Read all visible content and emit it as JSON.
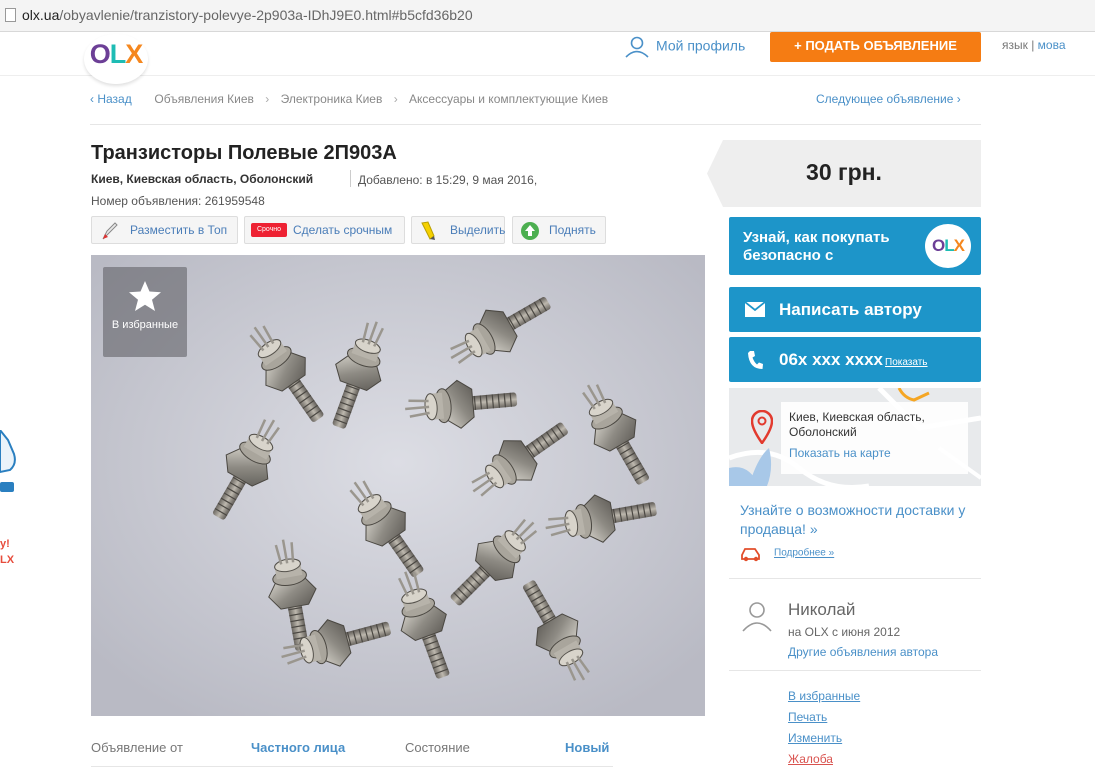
{
  "browser": {
    "url_domain": "olx.ua",
    "url_path": "/obyavlenie/tranzistory-polevye-2p903a-IDhJ9E0.html#b5cfd36b20"
  },
  "header": {
    "logo": "OLX",
    "profile_label": "Мой профиль",
    "post_button": "ПОДАТЬ ОБЪЯВЛЕНИЕ",
    "lang_label": "язык",
    "lang_switch": "мова"
  },
  "breadcrumb": {
    "back": "Назад",
    "items": [
      "Объявления Киев",
      "Электроника Киев",
      "Аксессуары и комплектующие Киев"
    ],
    "next": "Следующее объявление"
  },
  "ad": {
    "title": "Транзисторы Полевые 2П903А",
    "location": "Киев, Киевская область, Оболонский",
    "added": "Добавлено: в 15:29, 9 мая 2016,",
    "number": "Номер объявления: 261959548",
    "actions": [
      "Разместить в Топ",
      "Сделать срочным",
      "Выделить",
      "Поднять"
    ],
    "urgent_tag": "Срочно",
    "favorite_label": "В избранные",
    "details": [
      {
        "label": "Объявление от",
        "value": "Частного лица"
      },
      {
        "label": "Состояние",
        "value": "Новый"
      }
    ]
  },
  "sidebar": {
    "price": "30 грн.",
    "safe_text": "Узнай, как покупать безопасно с",
    "message_button": "Написать автору",
    "phone": "06x xxx xxxx",
    "phone_show": "Показать",
    "map_address": "Киев, Киевская область, Оболонский",
    "map_link": "Показать на карте",
    "delivery": "Узнайте о возможности доставки у продавца! »",
    "more": "Подробнее »",
    "seller_name": "Николай",
    "seller_since": "на OLX с июня 2012",
    "seller_other": "Другие объявления автора",
    "links": [
      "В избранные",
      "Печать",
      "Изменить",
      "Жалоба"
    ]
  },
  "left_edge": {
    "line1": "у!",
    "line2": "LX"
  },
  "colors": {
    "accent_blue": "#1d95c9",
    "link_blue": "#4a90c8",
    "orange": "#f57c13",
    "olx_purple": "#6c3f96",
    "olx_teal": "#1ebcb4"
  }
}
